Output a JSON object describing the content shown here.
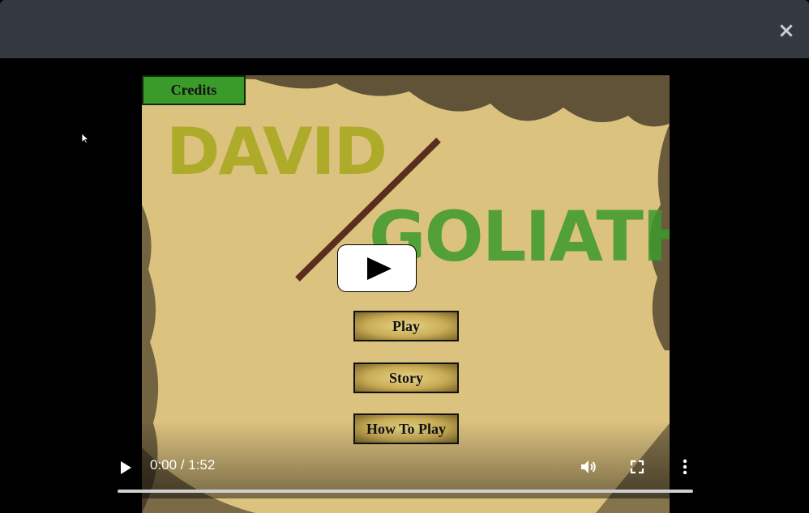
{
  "modal": {
    "close_label": "×"
  },
  "game": {
    "credits_label": "Credits",
    "title_david": "DAVID",
    "title_goliath": "GOLIATH",
    "menu": [
      {
        "label": "Play"
      },
      {
        "label": "Story"
      },
      {
        "label": "How To Play"
      }
    ]
  },
  "player": {
    "time": "0:00 / 1:52",
    "progress": 0.0,
    "icons": [
      "play-icon",
      "volume-icon",
      "fullscreen-icon",
      "more-options-icon",
      "youtube-play-icon"
    ]
  }
}
